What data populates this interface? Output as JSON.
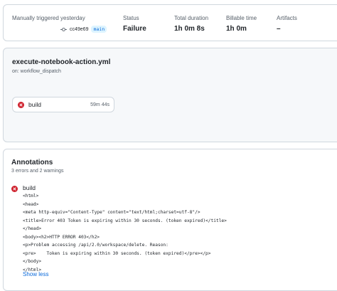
{
  "summary": {
    "trigger_label": "Manually triggered yesterday",
    "commit": "cc49e69",
    "branch": "main",
    "status_label": "Status",
    "status_value": "Failure",
    "duration_label": "Total duration",
    "duration_value": "1h 0m 8s",
    "billable_label": "Billable time",
    "billable_value": "1h 0m",
    "artifacts_label": "Artifacts",
    "artifacts_value": "–"
  },
  "workflow": {
    "name": "execute-notebook-action.yml",
    "trigger": "on: workflow_dispatch",
    "job": {
      "name": "build",
      "duration": "59m 44s",
      "status": "failure"
    }
  },
  "annotations": {
    "title": "Annotations",
    "summary": "3 errors and 2 warnings",
    "item": {
      "job": "build",
      "lines": [
        "<html>",
        "<head>",
        "<meta http-equiv=\"Content-Type\" content=\"text/html;charset=utf-8\"/>",
        "<title>Error 403 Token is expiring within 30 seconds. (token expired)</title>",
        "</head>",
        "<body><h2>HTTP ERROR 403</h2>",
        "<p>Problem accessing /api/2.0/workspace/delete. Reason:",
        "<pre>    Token is expiring within 30 seconds. (token expired)</pre></p>",
        "</body>",
        "</html>"
      ]
    },
    "show_less": "Show less"
  },
  "colors": {
    "error": "#cf222e",
    "link": "#0969da",
    "muted": "#57606a"
  },
  "icons": {
    "commit": "git-commit-icon",
    "error": "x-circle-icon"
  }
}
